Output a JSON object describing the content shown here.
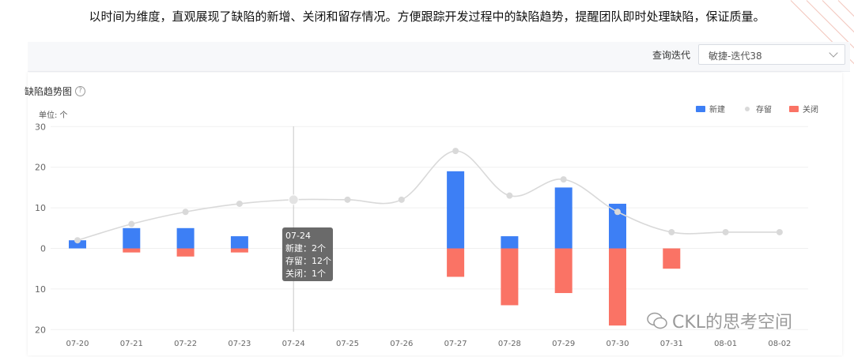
{
  "intro_text": "以时间为维度，直观展现了缺陷的新增、关闭和留存情况。方便跟踪开发过程中的缺陷趋势，提醒团队即时处理缺陷，保证质量。",
  "filter": {
    "label": "查询迭代",
    "value": "敏捷-迭代38"
  },
  "card": {
    "title": "缺陷趋势图",
    "unit": "单位: 个"
  },
  "tooltip": {
    "date": "07-24",
    "line1": "新建：2个",
    "line2": "存留：12个",
    "line3": "关闭：1个"
  },
  "watermark": "CKL的思考空间",
  "colors": {
    "new": "#3d7ff5",
    "retained": "#d9d9d9",
    "closed": "#fa7365",
    "axis_text": "#666666"
  },
  "chart_data": {
    "type": "bar",
    "categories": [
      "07-20",
      "07-21",
      "07-22",
      "07-23",
      "07-24",
      "07-25",
      "07-26",
      "07-27",
      "07-28",
      "07-29",
      "07-30",
      "07-31",
      "08-01",
      "08-02"
    ],
    "yticks": [
      "30",
      "20",
      "10",
      "0",
      "10",
      "20"
    ],
    "ylim": [
      -20,
      30
    ],
    "series": [
      {
        "name": "新建",
        "type": "bar",
        "values": [
          2,
          5,
          5,
          3,
          0,
          0,
          0,
          19,
          3,
          15,
          11,
          0,
          0,
          0
        ]
      },
      {
        "name": "存留",
        "type": "line",
        "values": [
          2,
          6,
          9,
          11,
          12,
          12,
          12,
          24,
          13,
          17,
          9,
          4,
          4,
          4
        ]
      },
      {
        "name": "关闭",
        "type": "bar",
        "values": [
          0,
          -1,
          -2,
          -1,
          0,
          0,
          0,
          -7,
          -14,
          -11,
          -19,
          -5,
          0,
          0
        ]
      }
    ],
    "highlight_category": "07-24",
    "legend_position": "top-right"
  }
}
